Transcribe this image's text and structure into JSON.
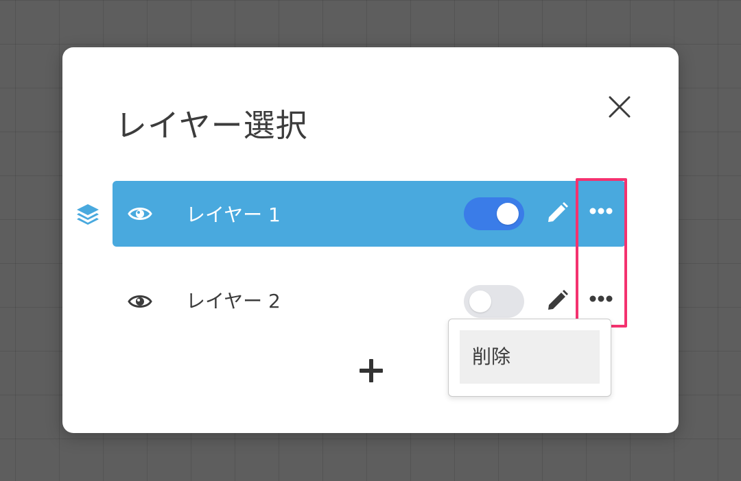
{
  "dialog": {
    "title": "レイヤー選択"
  },
  "layers": [
    {
      "name": "レイヤー 1",
      "active": true,
      "visible_toggle": "on"
    },
    {
      "name": "レイヤー 2",
      "active": false,
      "visible_toggle": "off"
    }
  ],
  "menu": {
    "delete_label": "削除"
  },
  "icons": {
    "close": "close-icon",
    "layers": "layers-icon",
    "eye": "eye-icon",
    "edit": "pencil-icon",
    "more": "more-horizontal-icon",
    "add": "plus-icon"
  },
  "colors": {
    "active_row": "#49a9de",
    "toggle_on": "#3a7ce8",
    "toggle_off": "#e3e4e8",
    "highlight": "#f4326f",
    "backdrop": "#5e5e5e"
  }
}
